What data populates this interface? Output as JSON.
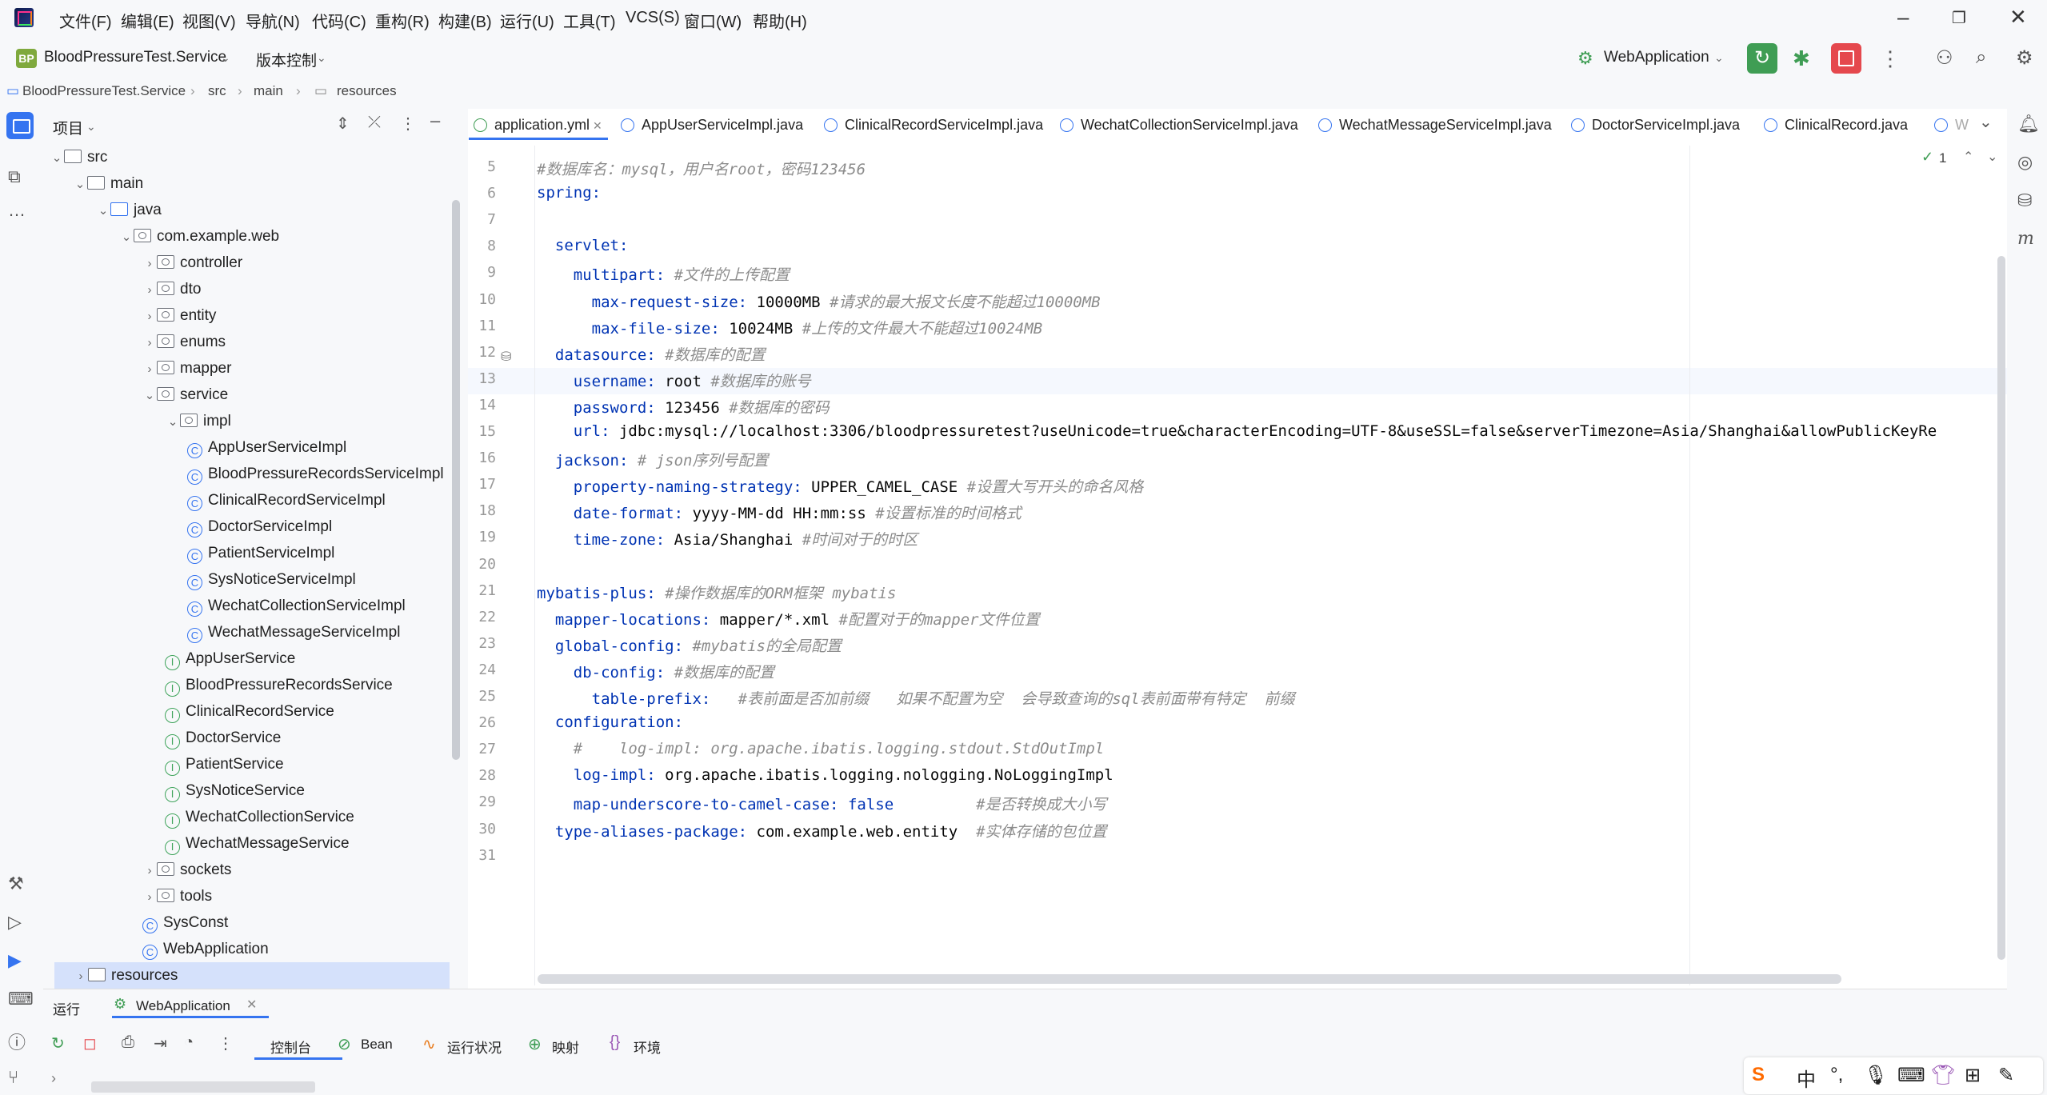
{
  "menu": [
    "文件(F)",
    "编辑(E)",
    "视图(V)",
    "导航(N)",
    "代码(C)",
    "重构(R)",
    "构建(B)",
    "运行(U)",
    "工具(T)",
    "VCS(S)",
    "窗口(W)",
    "帮助(H)"
  ],
  "toolbar": {
    "project_badge": "BP",
    "project_name": "BloodPressureTest.Service",
    "vcs": "版本控制",
    "run_config": "WebApplication"
  },
  "breadcrumb": [
    "BloodPressureTest.Service",
    "src",
    "main",
    "resources"
  ],
  "project_panel": {
    "title": "项目",
    "tree": [
      {
        "label": "src",
        "kind": "folder",
        "depth": 0,
        "open": true
      },
      {
        "label": "main",
        "kind": "folder",
        "depth": 1,
        "open": true
      },
      {
        "label": "java",
        "kind": "srcfolder",
        "depth": 2,
        "open": true
      },
      {
        "label": "com.example.web",
        "kind": "pkg",
        "depth": 3,
        "open": true
      },
      {
        "label": "controller",
        "kind": "pkg",
        "depth": 4,
        "open": false
      },
      {
        "label": "dto",
        "kind": "pkg",
        "depth": 4,
        "open": false
      },
      {
        "label": "entity",
        "kind": "pkg",
        "depth": 4,
        "open": false
      },
      {
        "label": "enums",
        "kind": "pkg",
        "depth": 4,
        "open": false
      },
      {
        "label": "mapper",
        "kind": "pkg",
        "depth": 4,
        "open": false
      },
      {
        "label": "service",
        "kind": "pkg",
        "depth": 4,
        "open": true
      },
      {
        "label": "impl",
        "kind": "pkg",
        "depth": 5,
        "open": true
      },
      {
        "label": "AppUserServiceImpl",
        "kind": "class",
        "depth": 6
      },
      {
        "label": "BloodPressureRecordsServiceImpl",
        "kind": "class",
        "depth": 6
      },
      {
        "label": "ClinicalRecordServiceImpl",
        "kind": "class",
        "depth": 6
      },
      {
        "label": "DoctorServiceImpl",
        "kind": "class",
        "depth": 6
      },
      {
        "label": "PatientServiceImpl",
        "kind": "class",
        "depth": 6
      },
      {
        "label": "SysNoticeServiceImpl",
        "kind": "class",
        "depth": 6
      },
      {
        "label": "WechatCollectionServiceImpl",
        "kind": "class",
        "depth": 6
      },
      {
        "label": "WechatMessageServiceImpl",
        "kind": "class",
        "depth": 6
      },
      {
        "label": "AppUserService",
        "kind": "interface",
        "depth": 5
      },
      {
        "label": "BloodPressureRecordsService",
        "kind": "interface",
        "depth": 5
      },
      {
        "label": "ClinicalRecordService",
        "kind": "interface",
        "depth": 5
      },
      {
        "label": "DoctorService",
        "kind": "interface",
        "depth": 5
      },
      {
        "label": "PatientService",
        "kind": "interface",
        "depth": 5
      },
      {
        "label": "SysNoticeService",
        "kind": "interface",
        "depth": 5
      },
      {
        "label": "WechatCollectionService",
        "kind": "interface",
        "depth": 5
      },
      {
        "label": "WechatMessageService",
        "kind": "interface",
        "depth": 5
      },
      {
        "label": "sockets",
        "kind": "pkg",
        "depth": 4,
        "open": false
      },
      {
        "label": "tools",
        "kind": "pkg",
        "depth": 4,
        "open": false
      },
      {
        "label": "SysConst",
        "kind": "class",
        "depth": 4
      },
      {
        "label": "WebApplication",
        "kind": "class",
        "depth": 4
      },
      {
        "label": "resources",
        "kind": "folder",
        "depth": 2,
        "open": false
      }
    ]
  },
  "tabs": [
    "application.yml",
    "AppUserServiceImpl.java",
    "ClinicalRecordServiceImpl.java",
    "WechatCollectionServiceImpl.java",
    "WechatMessageServiceImpl.java",
    "DoctorServiceImpl.java",
    "ClinicalRecord.java",
    "W"
  ],
  "editor": {
    "inspection_count": "1",
    "lines": [
      {
        "n": "5",
        "key": "",
        "val": "",
        "comment": "#数据库名：mysql，用户名root，密码123456"
      },
      {
        "n": "6",
        "key": "spring:",
        "val": "",
        "comment": ""
      },
      {
        "n": "7",
        "key": "",
        "val": "",
        "comment": ""
      },
      {
        "n": "8",
        "key": "  servlet:",
        "val": "",
        "comment": ""
      },
      {
        "n": "9",
        "key": "    multipart:",
        "val": " ",
        "comment": "#文件的上传配置"
      },
      {
        "n": "10",
        "key": "      max-request-size:",
        "val": " 10000MB ",
        "comment": "#请求的最大报文长度不能超过10000MB"
      },
      {
        "n": "11",
        "key": "      max-file-size:",
        "val": " 10024MB ",
        "comment": "#上传的文件最大不能超过10024MB"
      },
      {
        "n": "12",
        "key": "  datasource:",
        "val": " ",
        "comment": "#数据库的配置"
      },
      {
        "n": "13",
        "key": "    username:",
        "val": " root ",
        "comment": "#数据库的账号"
      },
      {
        "n": "14",
        "key": "    password:",
        "val": " 123456 ",
        "comment": "#数据库的密码"
      },
      {
        "n": "15",
        "key": "    url:",
        "val": " jdbc:mysql://localhost:3306/bloodpressuretest?useUnicode=true&characterEncoding=UTF-8&useSSL=false&serverTimezone=Asia/Shanghai&allowPublicKeyRe",
        "comment": ""
      },
      {
        "n": "16",
        "key": "  jackson:",
        "val": " ",
        "comment": "# json序列号配置"
      },
      {
        "n": "17",
        "key": "    property-naming-strategy:",
        "val": " UPPER_CAMEL_CASE ",
        "comment": "#设置大写开头的命名风格"
      },
      {
        "n": "18",
        "key": "    date-format:",
        "val": " yyyy-MM-dd HH:mm:ss ",
        "comment": "#设置标准的时间格式"
      },
      {
        "n": "19",
        "key": "    time-zone:",
        "val": " Asia/Shanghai ",
        "comment": "#时间对于的时区"
      },
      {
        "n": "20",
        "key": "",
        "val": "",
        "comment": ""
      },
      {
        "n": "21",
        "key": "mybatis-plus:",
        "val": " ",
        "comment": "#操作数据库的ORM框架 mybatis"
      },
      {
        "n": "22",
        "key": "  mapper-locations:",
        "val": " mapper/*.xml ",
        "comment": "#配置对于的mapper文件位置"
      },
      {
        "n": "23",
        "key": "  global-config:",
        "val": " ",
        "comment": "#mybatis的全局配置"
      },
      {
        "n": "24",
        "key": "    db-config:",
        "val": " ",
        "comment": "#数据库的配置"
      },
      {
        "n": "25",
        "key": "      table-prefix:",
        "val": "   ",
        "comment": "#表前面是否加前缀   如果不配置为空  会导致查询的sql表前面带有特定  前缀"
      },
      {
        "n": "26",
        "key": "  configuration:",
        "val": "",
        "comment": ""
      },
      {
        "n": "27",
        "key": "",
        "val": "    ",
        "comment": "#    log-impl: org.apache.ibatis.logging.stdout.StdOutImpl"
      },
      {
        "n": "28",
        "key": "    log-impl:",
        "val": " org.apache.ibatis.logging.nologging.NoLoggingImpl",
        "comment": ""
      },
      {
        "n": "29",
        "key": "    map-underscore-to-camel-case:",
        "val": " false         ",
        "comment": "#是否转换成大小写"
      },
      {
        "n": "30",
        "key": "  type-aliases-package:",
        "val": " com.example.web.entity  ",
        "comment": "#实体存储的包位置"
      },
      {
        "n": "31",
        "key": "",
        "val": "",
        "comment": ""
      }
    ]
  },
  "run_panel": {
    "title": "运行",
    "config_tab": "WebApplication",
    "tabs": [
      "控制台",
      "Bean",
      "运行状况",
      "映射",
      "环境"
    ]
  },
  "ime": {
    "chinese": "中"
  }
}
